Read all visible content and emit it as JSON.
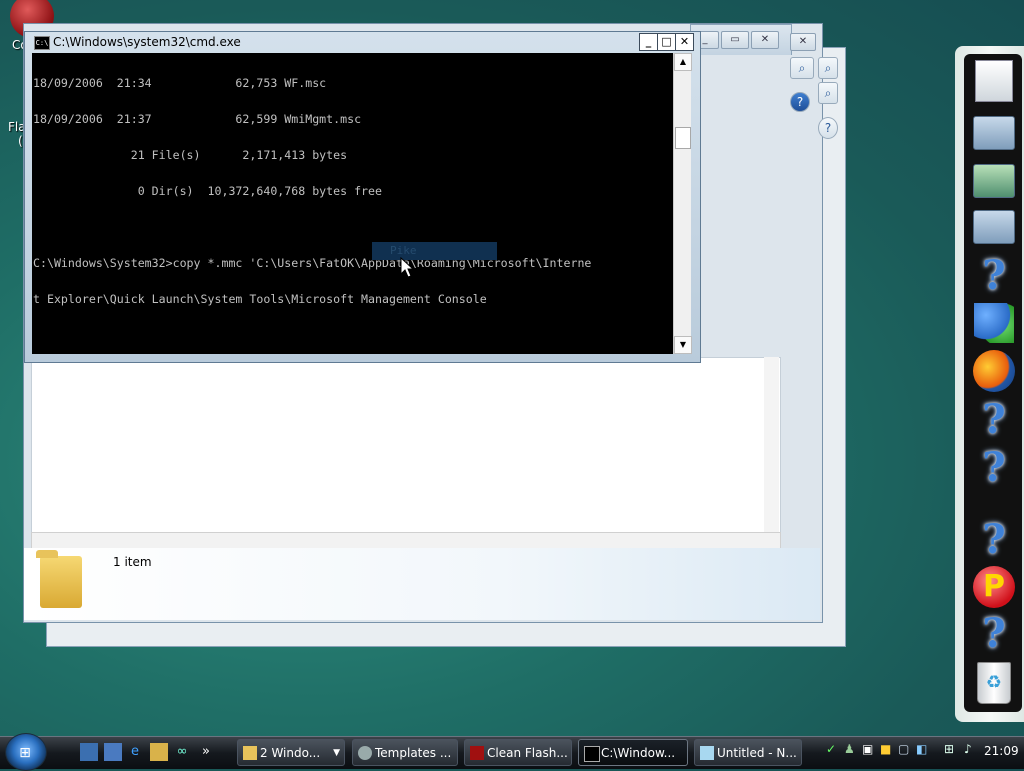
{
  "desktop": {
    "labels": [
      "Co",
      "Fla",
      "("
    ]
  },
  "explorer": {
    "item_count": "1 item",
    "search_icon": "search-icon",
    "help_icon": "help-icon"
  },
  "cmd": {
    "title": "C:\\Windows\\system32\\cmd.exe",
    "icon_text": "C:\\",
    "minimize": "_",
    "maximize": "□",
    "close": "✕",
    "lines": [
      "18/09/2006  21:34            62,753 WF.msc",
      "18/09/2006  21:37            62,599 WmiMgmt.msc",
      "              21 File(s)      2,171,413 bytes",
      "               0 Dir(s)  10,372,640,768 bytes free",
      "",
      "C:\\Windows\\System32>copy *.mmc 'C:\\Users\\FatOK\\AppData\\Roaming\\Microsoft\\Interne",
      "t Explorer\\Quick Launch\\System Tools\\Microsoft Management Console"
    ],
    "ghost_menu": "Pike"
  },
  "taskbar": {
    "buttons": [
      {
        "label": "2 Windo...",
        "icon": "folder-icon"
      },
      {
        "label": "Templates ...",
        "icon": "browser-icon"
      },
      {
        "label": "Clean Flash...",
        "icon": "flash-icon"
      },
      {
        "label": "C:\\Window...",
        "icon": "console-icon"
      },
      {
        "label": "Untitled - N...",
        "icon": "notepad-icon"
      }
    ],
    "overflow": "»",
    "clock": "21:09"
  },
  "sidebar": {
    "icons": [
      "document-icon",
      "folder-icon",
      "folder-icon",
      "folder-icon",
      "help-icon",
      "users-icon",
      "firefox-icon",
      "help-icon",
      "help-icon",
      "help-icon",
      "p-app-icon",
      "help-icon",
      "recycle-bin-icon"
    ]
  },
  "colors": {
    "console_bg": "#000000",
    "console_fg": "#c0c0c0",
    "desktop_bg": "#1f6e66",
    "taskbar_bg": "#15191e"
  }
}
